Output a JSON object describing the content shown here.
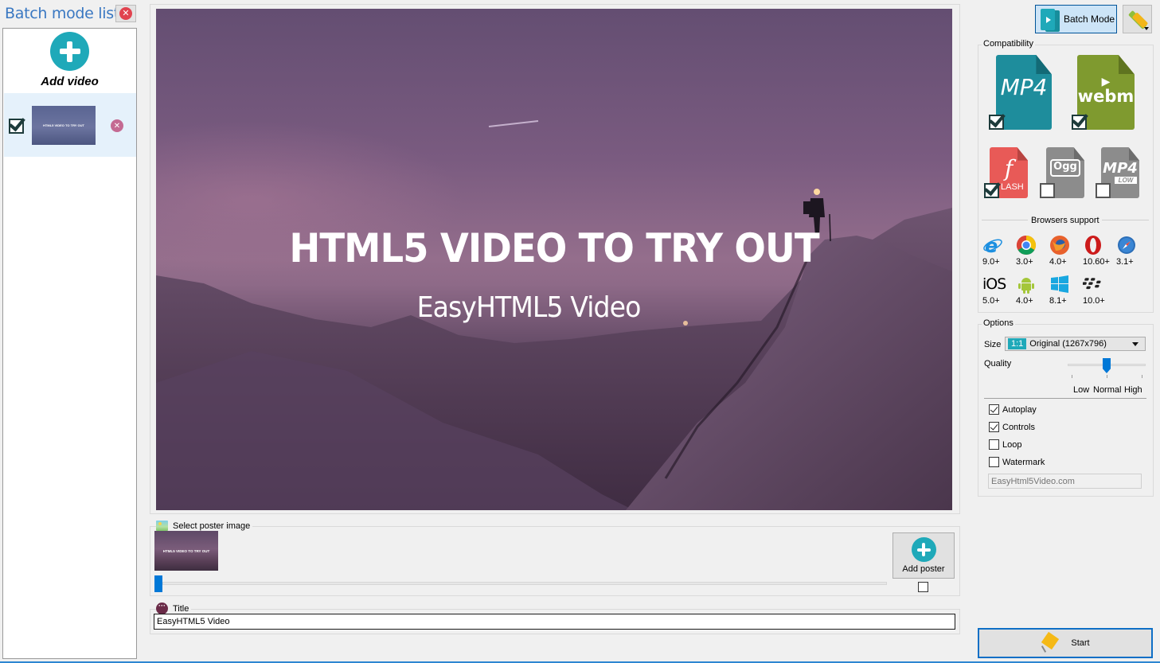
{
  "batch_panel": {
    "title": "Batch mode list",
    "add_video_label": "Add video",
    "items": [
      {
        "checked": true,
        "thumb_text": "HTML5 VIDEO TO TRY OUT"
      }
    ]
  },
  "preview": {
    "title_text": "HTML5 VIDEO TO TRY OUT",
    "subtitle_text": "EasyHTML5 Video",
    "colors": {
      "sky_top": "#644e72",
      "sky_mid": "#946e8c",
      "snow": "#4a3450"
    }
  },
  "poster": {
    "legend": "Select poster image",
    "thumb_text": "HTML5 VIDEO TO TRY OUT",
    "slider_position": 0,
    "add_poster_label": "Add poster",
    "add_poster_checked": false
  },
  "title_field": {
    "legend": "Title",
    "value": "EasyHTML5 Video"
  },
  "toolbar": {
    "batch_mode_label": "Batch Mode",
    "batch_mode_active": true,
    "tools_icon": "wrench-icon"
  },
  "compatibility": {
    "legend": "Compatibility",
    "formats": [
      {
        "id": "mp4",
        "label": "MP4",
        "checked": true,
        "color": "#1e8d9c"
      },
      {
        "id": "webm",
        "label": "webm",
        "checked": true,
        "color": "#7f9a2f"
      },
      {
        "id": "flash",
        "label": "f",
        "sub_label": "LASH",
        "checked": true,
        "color": "#e85a57"
      },
      {
        "id": "ogg",
        "label": "Ogg",
        "checked": false,
        "color": "#8c8c8c"
      },
      {
        "id": "mp4low",
        "label": "MP4",
        "sub_label": "LOW",
        "checked": false,
        "color": "#8c8c8c"
      }
    ],
    "browsers_label": "Browsers support",
    "browsers": [
      {
        "name": "internet-explorer",
        "version": "9.0+"
      },
      {
        "name": "chrome",
        "version": "3.0+"
      },
      {
        "name": "firefox",
        "version": "4.0+"
      },
      {
        "name": "opera",
        "version": "10.60+"
      },
      {
        "name": "safari",
        "version": "3.1+"
      },
      {
        "name": "ios",
        "label": "iOS",
        "version": "5.0+"
      },
      {
        "name": "android",
        "version": "4.0+"
      },
      {
        "name": "windows",
        "version": "8.1+"
      },
      {
        "name": "blackberry",
        "version": "10.0+"
      }
    ]
  },
  "options": {
    "legend": "Options",
    "size_label": "Size",
    "size_badge": "1:1",
    "size_value": "Original (1267x796)",
    "quality_label": "Quality",
    "quality_level": "Normal",
    "quality_ticks": [
      "Low",
      "Normal",
      "High"
    ],
    "checkboxes": [
      {
        "label": "Autoplay",
        "checked": true
      },
      {
        "label": "Controls",
        "checked": true
      },
      {
        "label": "Loop",
        "checked": false
      },
      {
        "label": "Watermark",
        "checked": false
      }
    ],
    "watermark_placeholder": "EasyHtml5Video.com"
  },
  "start_button": {
    "label": "Start"
  },
  "colors": {
    "accent": "#0078d7",
    "teal": "#1fa9b9",
    "batch_title": "#3a78c2"
  }
}
